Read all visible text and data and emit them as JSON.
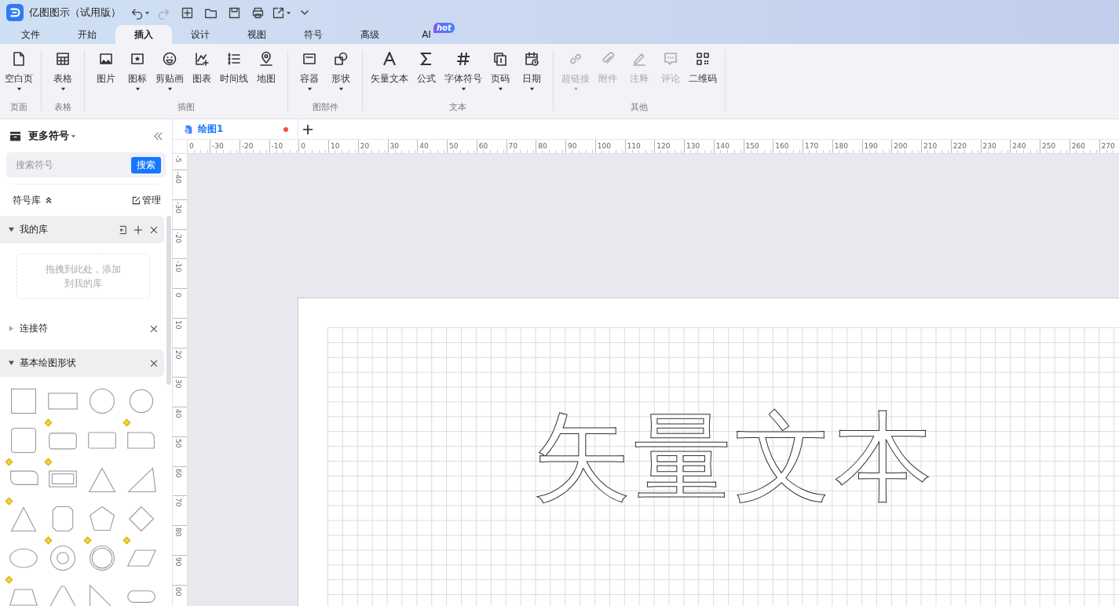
{
  "app": {
    "title": "亿图图示（试用版）"
  },
  "quick_toolbar": [
    {
      "dropdown": true,
      "disabled": false
    },
    {
      "dropdown": false,
      "disabled": true
    },
    {
      "dropdown": false,
      "disabled": false
    },
    {
      "dropdown": false,
      "disabled": false
    },
    {
      "dropdown": false,
      "disabled": false
    },
    {
      "dropdown": false,
      "disabled": false
    },
    {
      "dropdown": true,
      "disabled": false
    },
    {
      "dropdown": false,
      "disabled": false
    }
  ],
  "menu_tabs": [
    {
      "label": "文件",
      "selected": false
    },
    {
      "label": "开始",
      "selected": false
    },
    {
      "label": "插入",
      "selected": true
    },
    {
      "label": "设计",
      "selected": false
    },
    {
      "label": "视图",
      "selected": false
    },
    {
      "label": "符号",
      "selected": false
    },
    {
      "label": "高级",
      "selected": false
    },
    {
      "label": "AI",
      "selected": false,
      "badge": "hot"
    }
  ],
  "ribbon": {
    "groups": [
      {
        "label": "页面",
        "items": [
          {
            "label": "空白页",
            "dropdown": true,
            "disabled": false
          }
        ]
      },
      {
        "label": "表格",
        "items": [
          {
            "label": "表格",
            "dropdown": true,
            "disabled": false
          }
        ]
      },
      {
        "label": "插图",
        "items": [
          {
            "label": "图片",
            "dropdown": false,
            "disabled": false
          },
          {
            "label": "图标",
            "dropdown": true,
            "disabled": false
          },
          {
            "label": "剪贴画",
            "dropdown": true,
            "disabled": false
          },
          {
            "label": "图表",
            "dropdown": false,
            "disabled": false
          },
          {
            "label": "时间线",
            "dropdown": false,
            "disabled": false
          },
          {
            "label": "地图",
            "dropdown": false,
            "disabled": false
          }
        ]
      },
      {
        "label": "图部件",
        "items": [
          {
            "label": "容器",
            "dropdown": true,
            "disabled": false
          },
          {
            "label": "形状",
            "dropdown": true,
            "disabled": false
          }
        ]
      },
      {
        "label": "文本",
        "items": [
          {
            "label": "矢量文本",
            "dropdown": false,
            "disabled": false
          },
          {
            "label": "公式",
            "dropdown": false,
            "disabled": false
          },
          {
            "label": "字体符号",
            "dropdown": true,
            "disabled": false
          },
          {
            "label": "页码",
            "dropdown": true,
            "disabled": false
          },
          {
            "label": "日期",
            "dropdown": true,
            "disabled": false
          }
        ]
      },
      {
        "label": "其他",
        "items": [
          {
            "label": "超链接",
            "dropdown": true,
            "disabled": true
          },
          {
            "label": "附件",
            "dropdown": false,
            "disabled": true
          },
          {
            "label": "注释",
            "dropdown": false,
            "disabled": true
          },
          {
            "label": "评论",
            "dropdown": false,
            "disabled": true
          },
          {
            "label": "二维码",
            "dropdown": false,
            "disabled": false
          }
        ]
      }
    ]
  },
  "sidebar": {
    "title": "更多符号",
    "search": {
      "placeholder": "搜索符号",
      "button": "搜索"
    },
    "library_label": "符号库",
    "manage": "管理",
    "sections": [
      {
        "title": "我的库",
        "expanded": true,
        "drop_hint": "拖拽到此处，添加到我的库"
      },
      {
        "title": "连接符",
        "expanded": false
      },
      {
        "title": "基本绘图形状",
        "expanded": true
      }
    ],
    "shapes": [
      {
        "flagged": false
      },
      {
        "flagged": false
      },
      {
        "flagged": false
      },
      {
        "flagged": false
      },
      {
        "flagged": false
      },
      {
        "flagged": true
      },
      {
        "flagged": false
      },
      {
        "flagged": true
      },
      {
        "flagged": true
      },
      {
        "flagged": true
      },
      {
        "flagged": false
      },
      {
        "flagged": false
      },
      {
        "flagged": true
      },
      {
        "flagged": false
      },
      {
        "flagged": false
      },
      {
        "flagged": false
      },
      {
        "flagged": false
      },
      {
        "flagged": true
      },
      {
        "flagged": true
      },
      {
        "flagged": true
      },
      {
        "flagged": true
      },
      {
        "flagged": false
      },
      {
        "flagged": false
      },
      {
        "flagged": false
      }
    ]
  },
  "document_tab": {
    "title": "绘图1",
    "modified": true
  },
  "rulers": {
    "horizontal": [
      "0",
      "-30",
      "-20",
      "-10",
      "0",
      "10",
      "20",
      "30",
      "40",
      "50",
      "60",
      "70",
      "80",
      "90",
      "100",
      "110",
      "120",
      "130",
      "140",
      "150",
      "160",
      "170",
      "180",
      "190",
      "200",
      "210",
      "220",
      "230",
      "240",
      "250",
      "260",
      "270"
    ],
    "vertical": [
      "-5",
      "-40",
      "-30",
      "-20",
      "-10",
      "0",
      "10",
      "20",
      "30",
      "40",
      "50",
      "60",
      "70",
      "80",
      "90",
      "00"
    ]
  },
  "canvas": {
    "vector_text": "矢量文本"
  }
}
